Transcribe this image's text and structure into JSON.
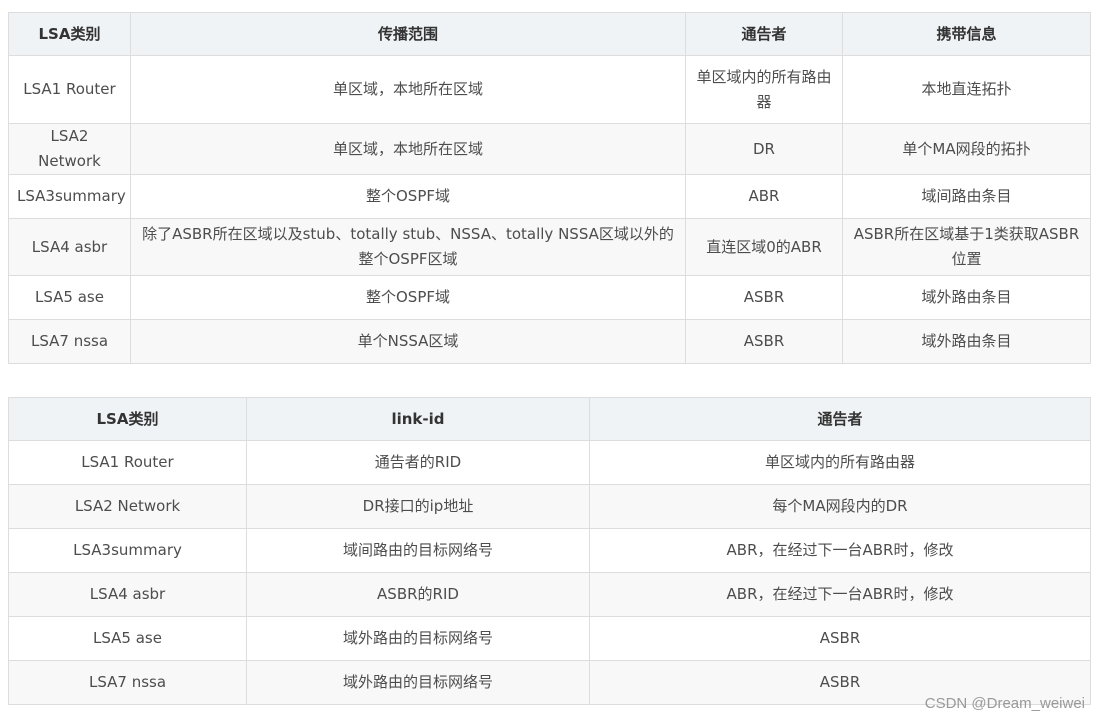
{
  "table1": {
    "headers": [
      "LSA类别",
      "传播范围",
      "通告者",
      "携带信息"
    ],
    "rows": [
      [
        "LSA1 Router",
        "单区域，本地所在区域",
        "单区域内的所有路由器",
        "本地直连拓扑"
      ],
      [
        "LSA2 Network",
        "单区域，本地所在区域",
        "DR",
        "单个MA网段的拓扑"
      ],
      [
        "LSA3summary",
        "整个OSPF域",
        "ABR",
        "域间路由条目"
      ],
      [
        "LSA4 asbr",
        "除了ASBR所在区域以及stub、totally stub、NSSA、totally NSSA区域以外的整个OSPF区域",
        "直连区域0的ABR",
        "ASBR所在区域基于1类获取ASBR位置"
      ],
      [
        "LSA5 ase",
        "整个OSPF域",
        "ASBR",
        "域外路由条目"
      ],
      [
        "LSA7 nssa",
        "单个NSSA区域",
        "ASBR",
        "域外路由条目"
      ]
    ]
  },
  "table2": {
    "headers": [
      "LSA类别",
      "link-id",
      "通告者"
    ],
    "rows": [
      [
        "LSA1 Router",
        "通告者的RID",
        "单区域内的所有路由器"
      ],
      [
        "LSA2 Network",
        "DR接口的ip地址",
        "每个MA网段内的DR"
      ],
      [
        "LSA3summary",
        "域间路由的目标网络号",
        "ABR，在经过下一台ABR时，修改"
      ],
      [
        "LSA4 asbr",
        "ASBR的RID",
        "ABR，在经过下一台ABR时，修改"
      ],
      [
        "LSA5 ase",
        "域外路由的目标网络号",
        "ASBR"
      ],
      [
        "LSA7 nssa",
        "域外路由的目标网络号",
        "ASBR"
      ]
    ]
  },
  "watermark": "CSDN @Dream_weiwei"
}
